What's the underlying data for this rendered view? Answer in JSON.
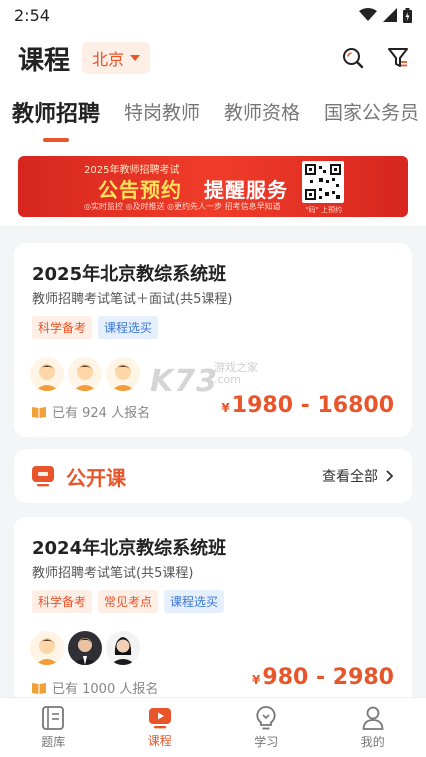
{
  "status": {
    "time": "2:54"
  },
  "header": {
    "title": "课程",
    "city": "北京"
  },
  "tabs": [
    {
      "label": "教师招聘",
      "active": true
    },
    {
      "label": "特岗教师",
      "active": false
    },
    {
      "label": "教师资格",
      "active": false
    },
    {
      "label": "国家公务员",
      "active": false
    }
  ],
  "banner": {
    "subtitle": "2025年教师招聘考试",
    "headline_a": "公告预约",
    "headline_b": "提醒服务",
    "features": "◎实时监控 ◎及时推送 ◎更约先人一步 招考信息早知道",
    "qr_note": "\"码\" 上预约"
  },
  "courses": [
    {
      "title": "2025年北京教综系统班",
      "desc": "教师招聘考试笔试＋面试(共5课程)",
      "tags": [
        "科学备考",
        "课程选买"
      ],
      "enroll": "已有 924 人报名",
      "currency": "¥",
      "price": "1980 - 16800"
    },
    {
      "title": "2024年北京教综系统班",
      "desc": "教师招聘考试笔试(共5课程)",
      "tags": [
        "科学备考",
        "常见考点",
        "课程选买"
      ],
      "enroll": "已有 1000 人报名",
      "currency": "¥",
      "price": "980 - 2980"
    }
  ],
  "open_course": {
    "title": "公开课",
    "view_all": "查看全部"
  },
  "watermark": {
    "brand": "K73",
    "line1": "游戏之家",
    "line2": ".com"
  },
  "bottom_nav": [
    {
      "label": "题库",
      "icon": "question-bank-icon",
      "active": false
    },
    {
      "label": "课程",
      "icon": "course-play-icon",
      "active": true
    },
    {
      "label": "学习",
      "icon": "bulb-icon",
      "active": false
    },
    {
      "label": "我的",
      "icon": "user-icon",
      "active": false
    }
  ],
  "colors": {
    "accent": "#e8552a",
    "tag_blue": "#3a78d8",
    "banner_red": "#d7261f"
  }
}
